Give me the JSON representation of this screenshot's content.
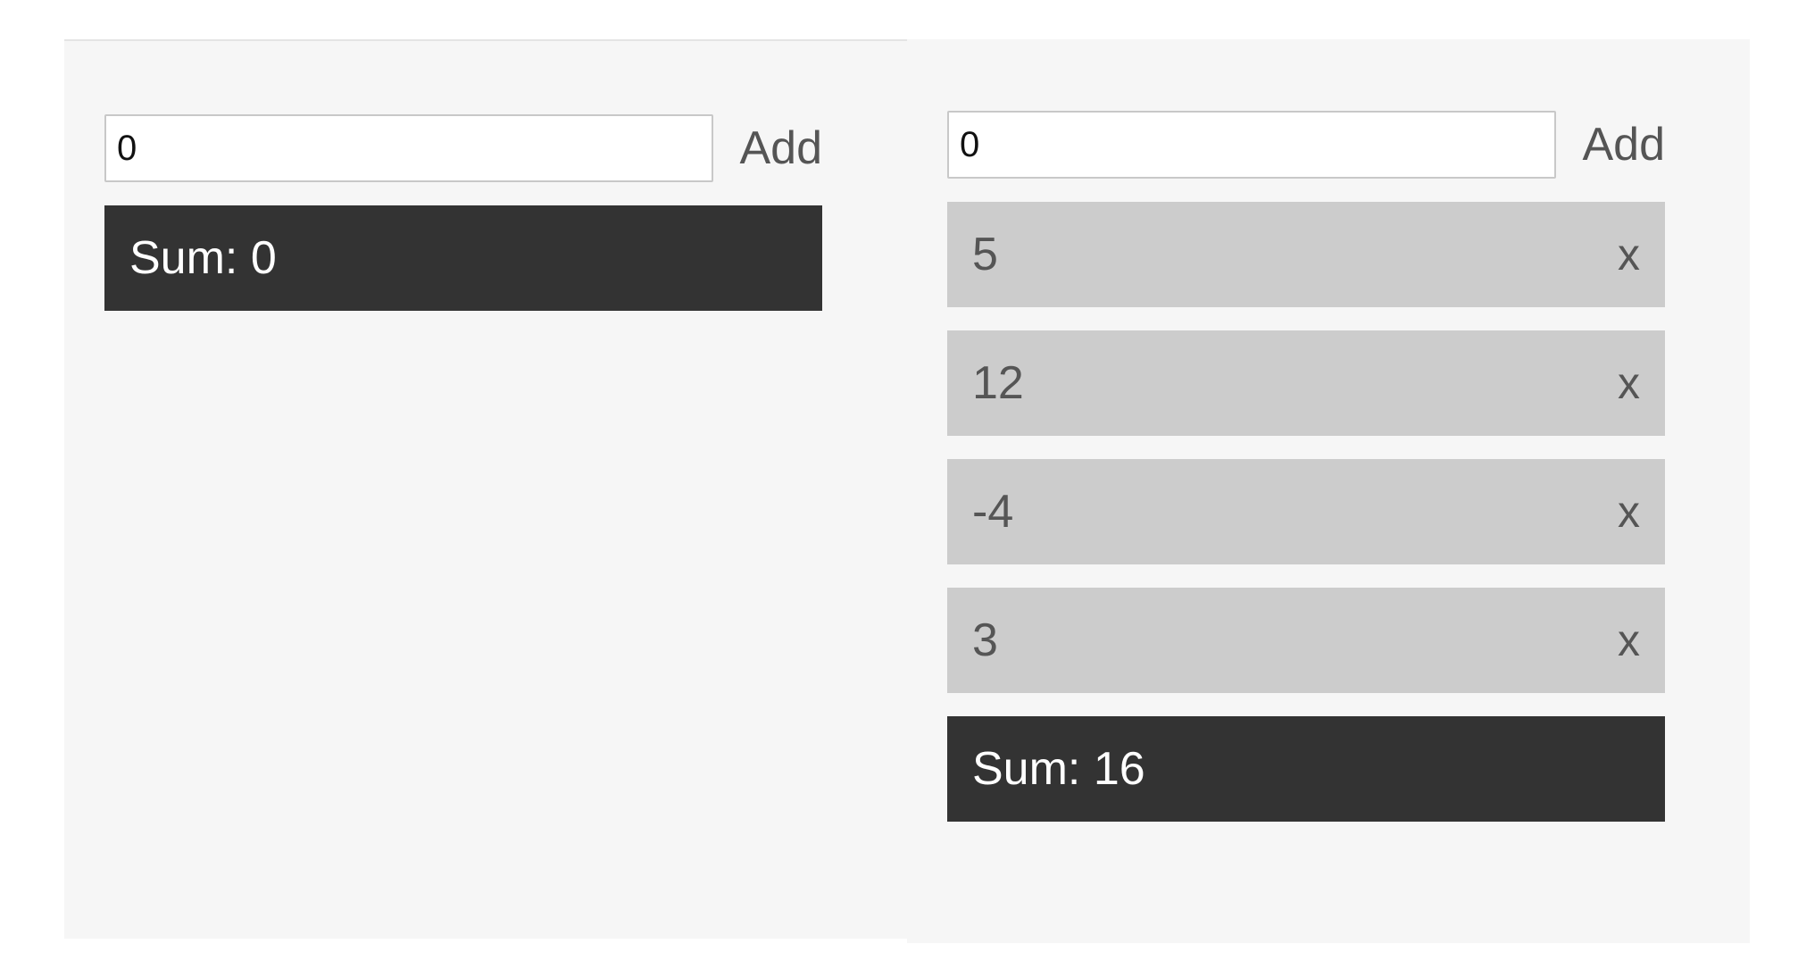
{
  "left_panel": {
    "input_value": "0",
    "add_label": "Add",
    "items": [],
    "sum_label": "Sum: 0"
  },
  "right_panel": {
    "input_value": "0",
    "add_label": "Add",
    "items": [
      {
        "value": "5",
        "remove_label": "x"
      },
      {
        "value": "12",
        "remove_label": "x"
      },
      {
        "value": "-4",
        "remove_label": "x"
      },
      {
        "value": "3",
        "remove_label": "x"
      }
    ],
    "sum_label": "Sum: 16"
  },
  "colors": {
    "panel_bg": "#f6f6f6",
    "item_bg": "#cccccc",
    "sum_bg": "#333333",
    "text_muted": "#555555"
  }
}
